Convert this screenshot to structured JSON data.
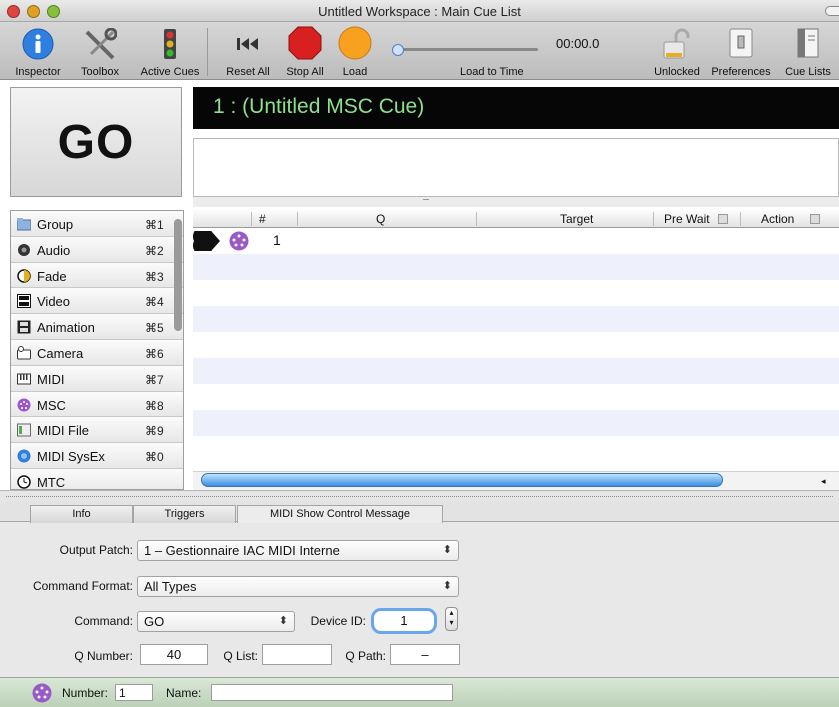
{
  "window": {
    "title": "Untitled Workspace : Main Cue List"
  },
  "toolbar": {
    "inspector": "Inspector",
    "toolbox": "Toolbox",
    "active_cues": "Active Cues",
    "reset_all": "Reset All",
    "stop_all": "Stop All",
    "load": "Load",
    "load_to_time": "Load to Time",
    "time": "00:00.0",
    "unlocked": "Unlocked",
    "preferences": "Preferences",
    "cue_lists": "Cue Lists",
    "load_time_slider": 0
  },
  "go": {
    "label": "GO"
  },
  "current_cue": {
    "title": "1 : (Untitled MSC Cue)"
  },
  "cue_types": [
    {
      "label": "Group",
      "key": "⌘1",
      "icon": "folder-icon"
    },
    {
      "label": "Audio",
      "key": "⌘2",
      "icon": "speaker-icon"
    },
    {
      "label": "Fade",
      "key": "⌘3",
      "icon": "fade-icon"
    },
    {
      "label": "Video",
      "key": "⌘4",
      "icon": "video-icon"
    },
    {
      "label": "Animation",
      "key": "⌘5",
      "icon": "film-icon"
    },
    {
      "label": "Camera",
      "key": "⌘6",
      "icon": "camera-icon"
    },
    {
      "label": "MIDI",
      "key": "⌘7",
      "icon": "piano-icon"
    },
    {
      "label": "MSC",
      "key": "⌘8",
      "icon": "midi-connector-icon"
    },
    {
      "label": "MIDI File",
      "key": "⌘9",
      "icon": "midi-file-icon"
    },
    {
      "label": "MIDI SysEx",
      "key": "⌘0",
      "icon": "sysex-icon"
    },
    {
      "label": "MTC",
      "key": "",
      "icon": "clock-icon"
    }
  ],
  "table": {
    "columns": {
      "number": "#",
      "q": "Q",
      "target": "Target",
      "pre_wait": "Pre Wait",
      "action": "Action"
    },
    "rows": [
      {
        "number": "1",
        "q": "",
        "target": "",
        "pre_wait": "",
        "action": ""
      }
    ]
  },
  "inspector": {
    "tabs": [
      "Info",
      "Triggers",
      "MIDI Show Control Message"
    ],
    "active_tab": "MIDI Show Control Message",
    "output_patch_label": "Output Patch:",
    "output_patch_value": "1 – Gestionnaire IAC MIDI Interne",
    "command_format_label": "Command Format:",
    "command_format_value": "All Types",
    "command_label": "Command:",
    "command_value": "GO",
    "device_id_label": "Device ID:",
    "device_id_value": "1",
    "q_number_label": "Q Number:",
    "q_number_value": "40",
    "q_list_label": "Q List:",
    "q_list_value": "",
    "q_path_label": "Q Path:",
    "q_path_value": "–"
  },
  "footer": {
    "number_label": "Number:",
    "number_value": "1",
    "name_label": "Name:",
    "name_value": ""
  },
  "colors": {
    "cue_title": "#8fe08c",
    "stop": "#d92020",
    "load": "#f8a020",
    "info_blue": "#2f7fe0",
    "msc_purple": "#9b59c8"
  }
}
